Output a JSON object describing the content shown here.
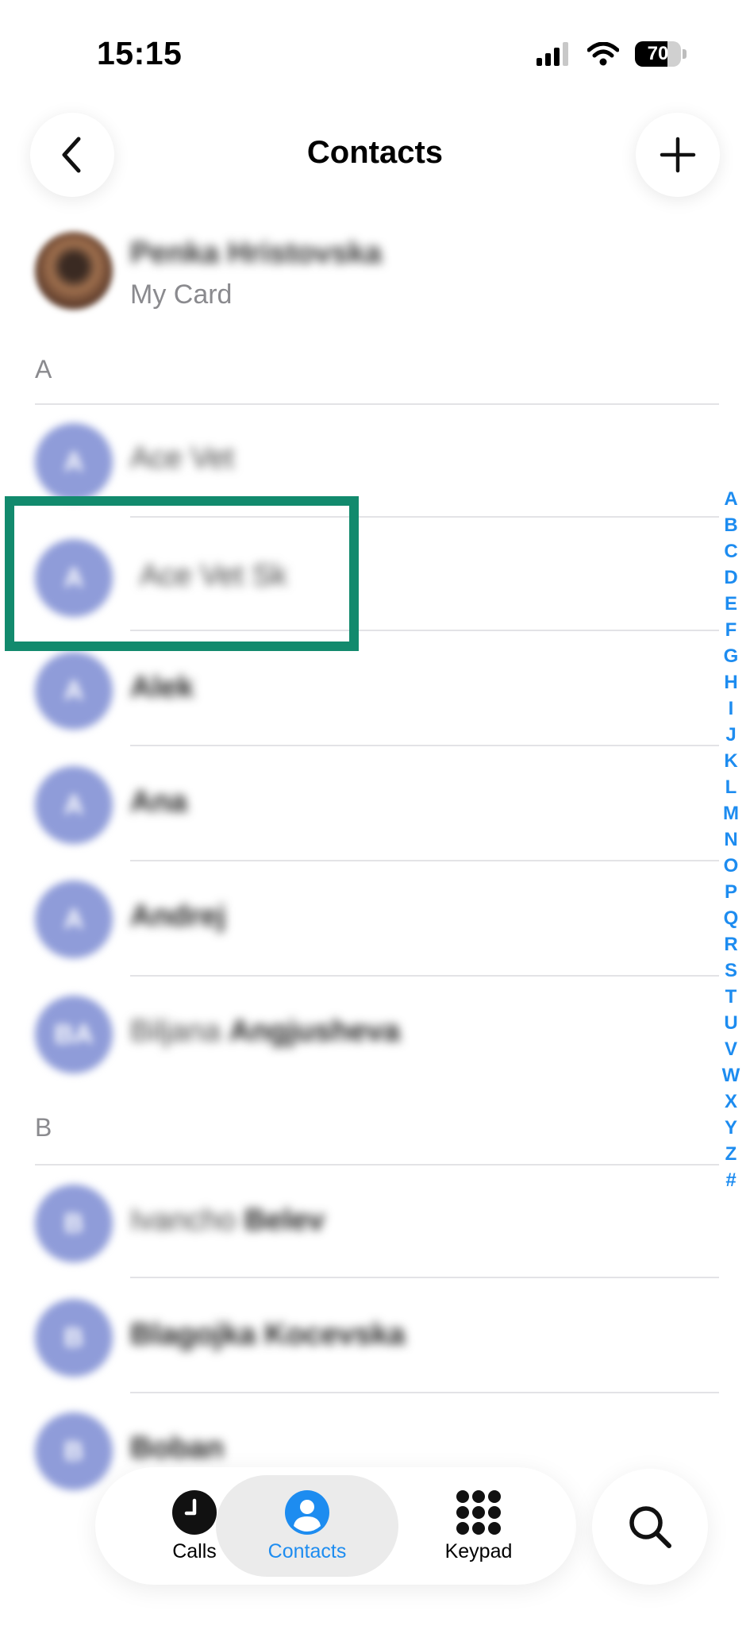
{
  "status": {
    "time": "15:15",
    "battery": "70",
    "battery_level": 0.7
  },
  "header": {
    "title": "Contacts",
    "back_icon": "chevron-left-icon",
    "add_icon": "plus-icon"
  },
  "my_card": {
    "name": "Penka Hristovska",
    "subtitle": "My Card"
  },
  "sections": [
    {
      "letter": "A",
      "contacts": [
        {
          "initials": "A",
          "first": "Ace Vet",
          "last": ""
        },
        {
          "initials": "A",
          "first": "Ace Vet Sk",
          "last": ""
        },
        {
          "initials": "A",
          "first": "Alek",
          "last": ""
        },
        {
          "initials": "A",
          "first": "Ana",
          "last": ""
        },
        {
          "initials": "A",
          "first": "Andrej",
          "last": ""
        },
        {
          "initials": "BA",
          "first": "Biljana",
          "last": "Angjusheva"
        }
      ]
    },
    {
      "letter": "B",
      "contacts": [
        {
          "initials": "B",
          "first": "Ivancho",
          "last": "Belev"
        },
        {
          "initials": "B",
          "first": "Blagojka Kocevska",
          "last": ""
        },
        {
          "initials": "B",
          "first": "Boban",
          "last": ""
        }
      ]
    }
  ],
  "index": [
    "A",
    "B",
    "C",
    "D",
    "E",
    "F",
    "G",
    "H",
    "I",
    "J",
    "K",
    "L",
    "M",
    "N",
    "O",
    "P",
    "Q",
    "R",
    "S",
    "T",
    "U",
    "V",
    "W",
    "X",
    "Y",
    "Z",
    "#"
  ],
  "tabs": [
    {
      "label": "Calls",
      "icon": "clock-icon"
    },
    {
      "label": "Contacts",
      "icon": "person-circle-icon",
      "active": true
    },
    {
      "label": "Keypad",
      "icon": "keypad-icon"
    }
  ],
  "colors": {
    "accent": "#1d8cf0",
    "highlight": "#128a6d",
    "avatar": "#8f9cd9"
  }
}
